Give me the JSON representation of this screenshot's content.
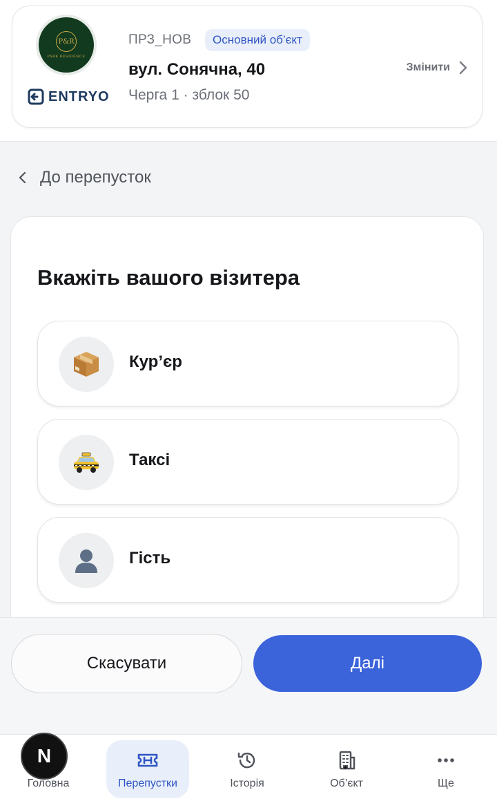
{
  "header": {
    "logo_text": "PARK RESIDENCE",
    "logo_mark": "P&R",
    "brand": "ENTRYO",
    "object_code": "ПРЗ_НОВ",
    "object_badge": "Основний об’єкт",
    "address": "вул. Сонячна, 40",
    "subtitle": "Черга 1 · зблок 50",
    "change_label": "Змінити"
  },
  "back": {
    "label": "До перепусток",
    "icon": "chevron-left-icon"
  },
  "visitor": {
    "title": "Вкажіть вашого візитера",
    "options": [
      {
        "label": "Кур’єр",
        "icon": "package-icon"
      },
      {
        "label": "Таксі",
        "icon": "taxi-icon"
      },
      {
        "label": "Гість",
        "icon": "person-icon"
      }
    ]
  },
  "actions": {
    "cancel_label": "Скасувати",
    "next_label": "Далі",
    "accent": "#3b63da"
  },
  "nav": {
    "items": [
      {
        "label": "Головна",
        "icon": "home-icon"
      },
      {
        "label": "Перепустки",
        "icon": "ticket-icon",
        "active": true
      },
      {
        "label": "Історія",
        "icon": "history-icon"
      },
      {
        "label": "Об’єкт",
        "icon": "building-icon"
      },
      {
        "label": "Ще",
        "icon": "more-icon"
      }
    ],
    "badge_letter": "N"
  }
}
